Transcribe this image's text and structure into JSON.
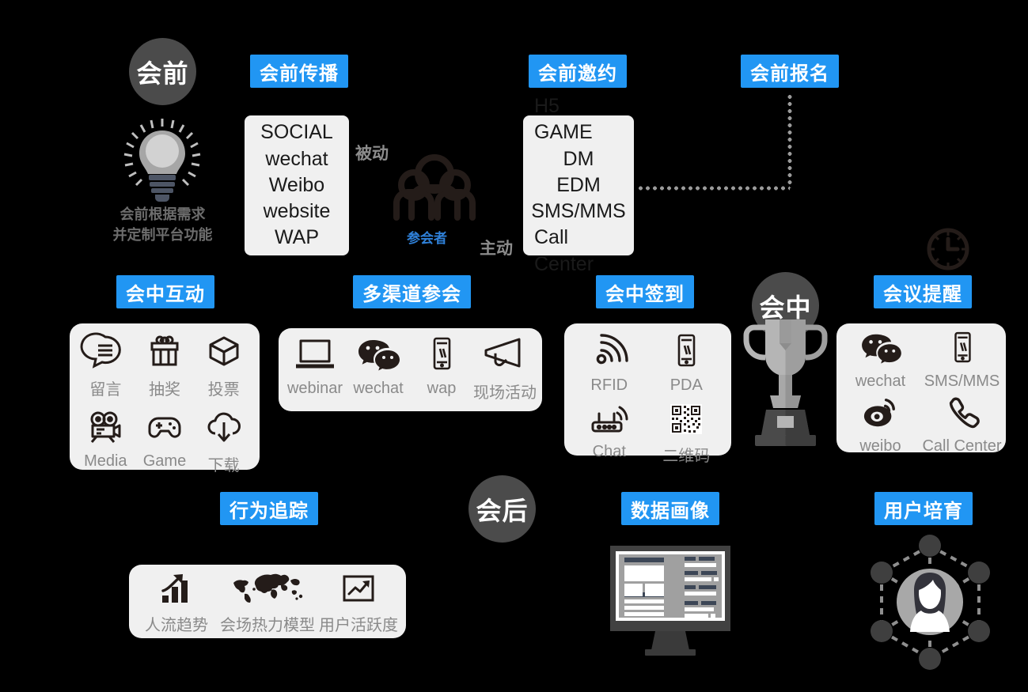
{
  "background": "#000000",
  "accent_blue": "#2196f3",
  "circle_gray": "#4b4b4b",
  "card_bg": "#f0f0f0",
  "phases": {
    "pre": "会前",
    "during": "会中",
    "post": "会后"
  },
  "tags": {
    "pre_spread": "会前传播",
    "pre_invite": "会前邀约",
    "pre_signup": "会前报名",
    "during_interact": "会中互动",
    "multi_channel": "多渠道参会",
    "during_checkin": "会中签到",
    "meeting_remind": "会议提醒",
    "behavior_track": "行为追踪",
    "data_portrait": "数据画像",
    "user_nurture": "用户培育"
  },
  "bulb_caption": {
    "line1": "会前根据需求",
    "line2": "并定制平台功能"
  },
  "spread_channels": [
    "SOCIAL",
    "wechat",
    "Weibo",
    "website",
    "WAP"
  ],
  "invite_channels": [
    "H5 GAME",
    "DM",
    "EDM",
    "SMS/MMS",
    "Call Center"
  ],
  "audience": {
    "passive": "被动",
    "active": "主动",
    "attendee": "参会者"
  },
  "interaction_items": [
    {
      "label": "留言",
      "icon": "message-bubble-icon"
    },
    {
      "label": "抽奖",
      "icon": "gift-box-icon"
    },
    {
      "label": "投票",
      "icon": "open-box-icon"
    },
    {
      "label": "Media",
      "icon": "film-camera-icon"
    },
    {
      "label": "Game",
      "icon": "gamepad-icon"
    },
    {
      "label": "下载",
      "icon": "cloud-download-icon"
    }
  ],
  "channel_items": [
    {
      "label": "webinar",
      "icon": "laptop-icon"
    },
    {
      "label": "wechat",
      "icon": "wechat-icon"
    },
    {
      "label": "wap",
      "icon": "mobile-phone-icon"
    },
    {
      "label": "现场活动",
      "icon": "megaphone-icon"
    }
  ],
  "checkin_items": [
    {
      "label": "RFID",
      "icon": "rfid-signal-icon"
    },
    {
      "label": "PDA",
      "icon": "mobile-phone-icon"
    },
    {
      "label": "Chat",
      "icon": "router-icon"
    },
    {
      "label": "二维码",
      "icon": "qr-code-icon"
    }
  ],
  "remind_items": [
    {
      "label": "wechat",
      "icon": "wechat-icon"
    },
    {
      "label": "SMS/MMS",
      "icon": "mobile-phone-icon"
    },
    {
      "label": "weibo",
      "icon": "weibo-icon"
    },
    {
      "label": "Call Center",
      "icon": "phone-handset-icon"
    }
  ],
  "tracking_items": [
    {
      "label": "人流趋势",
      "icon": "bar-chart-arrow-icon"
    },
    {
      "label": "会场热力模型",
      "icon": "world-map-icon"
    },
    {
      "label": "用户活跃度",
      "icon": "trend-chart-icon"
    }
  ],
  "decorative_icons": {
    "lightbulb": "lightbulb-icon",
    "attendees": "people-group-icon",
    "trophy": "trophy-icon",
    "clock": "clock-icon",
    "monitor": "desktop-monitor-icon",
    "network": "user-network-icon"
  }
}
